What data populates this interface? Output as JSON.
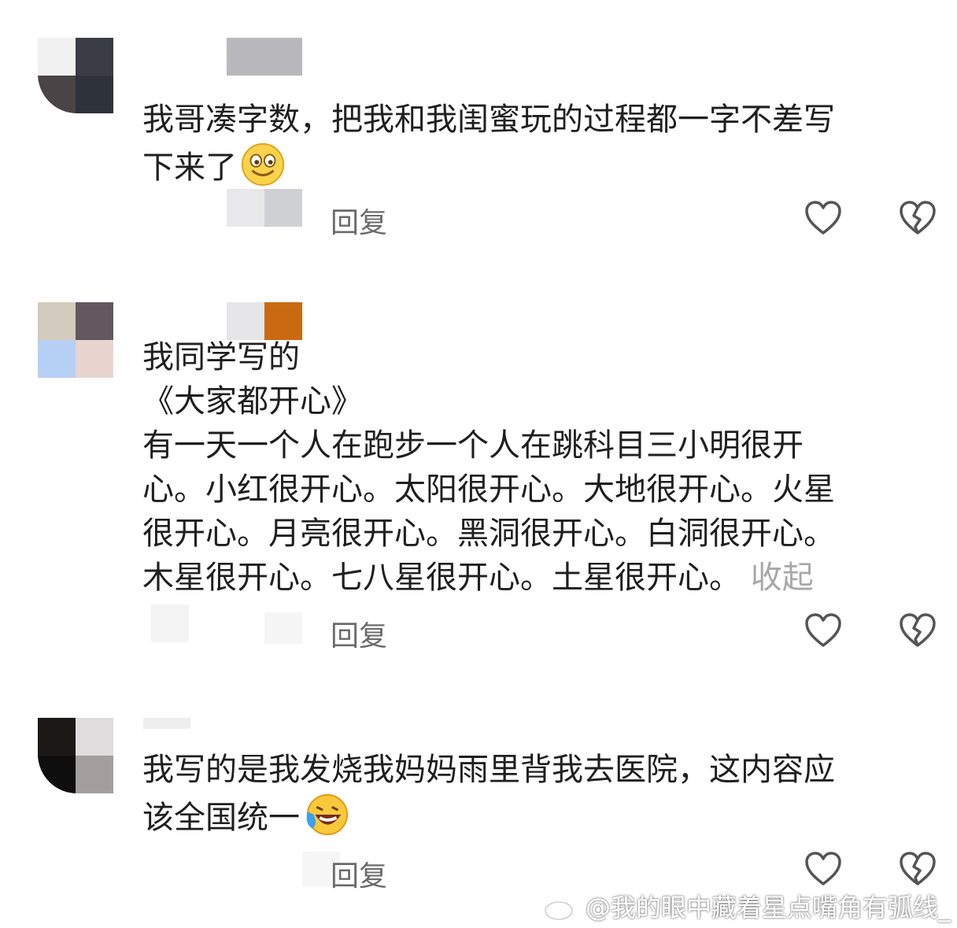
{
  "comments": [
    {
      "text": "我哥凑字数，把我和我闺蜜玩的过程都一字不差写\n下来了",
      "emoji": "grin-emoji",
      "reply_label": "回复"
    },
    {
      "text_lines": [
        "我同学写的",
        "《大家都开心》",
        "有一天一个人在跑步一个人在跳科目三小明很开",
        "心。小红很开心。太阳很开心。大地很开心。火星",
        "很开心。月亮很开心。黑洞很开心。白洞很开心。",
        "木星很开心。七八星很开心。土星很开心。"
      ],
      "collapse_label": "收起",
      "reply_label": "回复"
    },
    {
      "text": "我写的是我发烧我妈妈雨里背我去医院，这内容应\n该全国统一",
      "emoji": "laugh-cry-emoji",
      "reply_label": "回复"
    }
  ],
  "watermark": "@我的眼中藏着星点嘴角有弧线_",
  "colors": {
    "text": "#1f1f1f",
    "reply": "#6b6b6b",
    "collapse": "#a8a8a8",
    "icon": "#555555"
  }
}
